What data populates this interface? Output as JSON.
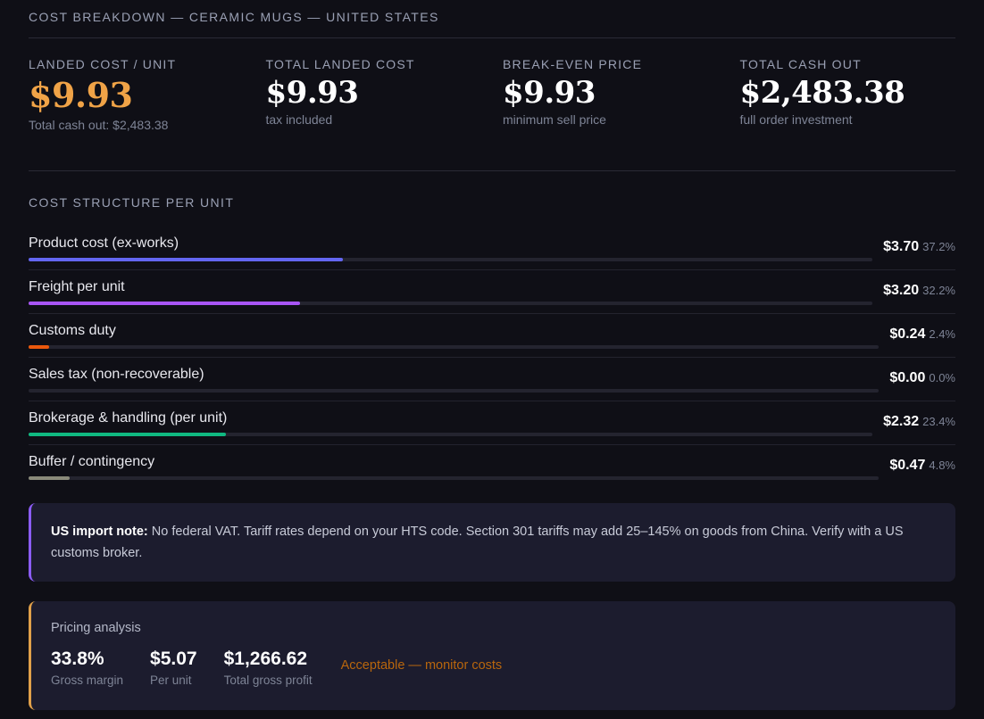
{
  "header": {
    "title": "COST BREAKDOWN — CERAMIC MUGS — UNITED STATES"
  },
  "metrics": [
    {
      "label": "LANDED COST / UNIT",
      "value": "$9.93",
      "sub": "Total cash out: $2,483.38"
    },
    {
      "label": "TOTAL LANDED COST",
      "value": "$9.93",
      "sub": "tax included"
    },
    {
      "label": "BREAK-EVEN PRICE",
      "value": "$9.93",
      "sub": "minimum sell price"
    },
    {
      "label": "TOTAL CASH OUT",
      "value": "$2,483.38",
      "sub": "full order investment"
    }
  ],
  "cost_structure": {
    "title": "COST STRUCTURE PER UNIT",
    "rows": [
      {
        "name": "Product cost (ex-works)",
        "amount": "$3.70",
        "percent": "37.2%",
        "share": 0.372,
        "color": "#6366f1"
      },
      {
        "name": "Freight per unit",
        "amount": "$3.20",
        "percent": "32.2%",
        "share": 0.322,
        "color": "#a855f7"
      },
      {
        "name": "Customs duty",
        "amount": "$0.24",
        "percent": "2.4%",
        "share": 0.024,
        "color": "#ea580c"
      },
      {
        "name": "Sales tax (non-recoverable)",
        "amount": "$0.00",
        "percent": "0.0%",
        "share": 0.0,
        "color": "#ef4444"
      },
      {
        "name": "Brokerage & handling (per unit)",
        "amount": "$2.32",
        "percent": "23.4%",
        "share": 0.234,
        "color": "#10b981"
      },
      {
        "name": "Buffer / contingency",
        "amount": "$0.47",
        "percent": "4.8%",
        "share": 0.048,
        "color": "#8a8a7a"
      }
    ]
  },
  "note": {
    "label": "US import note:",
    "text": " No federal VAT. Tariff rates depend on your HTS code. Section 301 tariffs may add 25–145% on goods from China. Verify with a US customs broker.",
    "accent": "#8b5cf6"
  },
  "pricing": {
    "title": "Pricing analysis",
    "accent": "#e0a04a",
    "stats": [
      {
        "value": "33.8%",
        "label": "Gross margin"
      },
      {
        "value": "$5.07",
        "label": "Per unit"
      },
      {
        "value": "$1,266.62",
        "label": "Total gross profit"
      }
    ],
    "verdict": "Acceptable — monitor costs",
    "verdict_color": "#b8660d"
  }
}
